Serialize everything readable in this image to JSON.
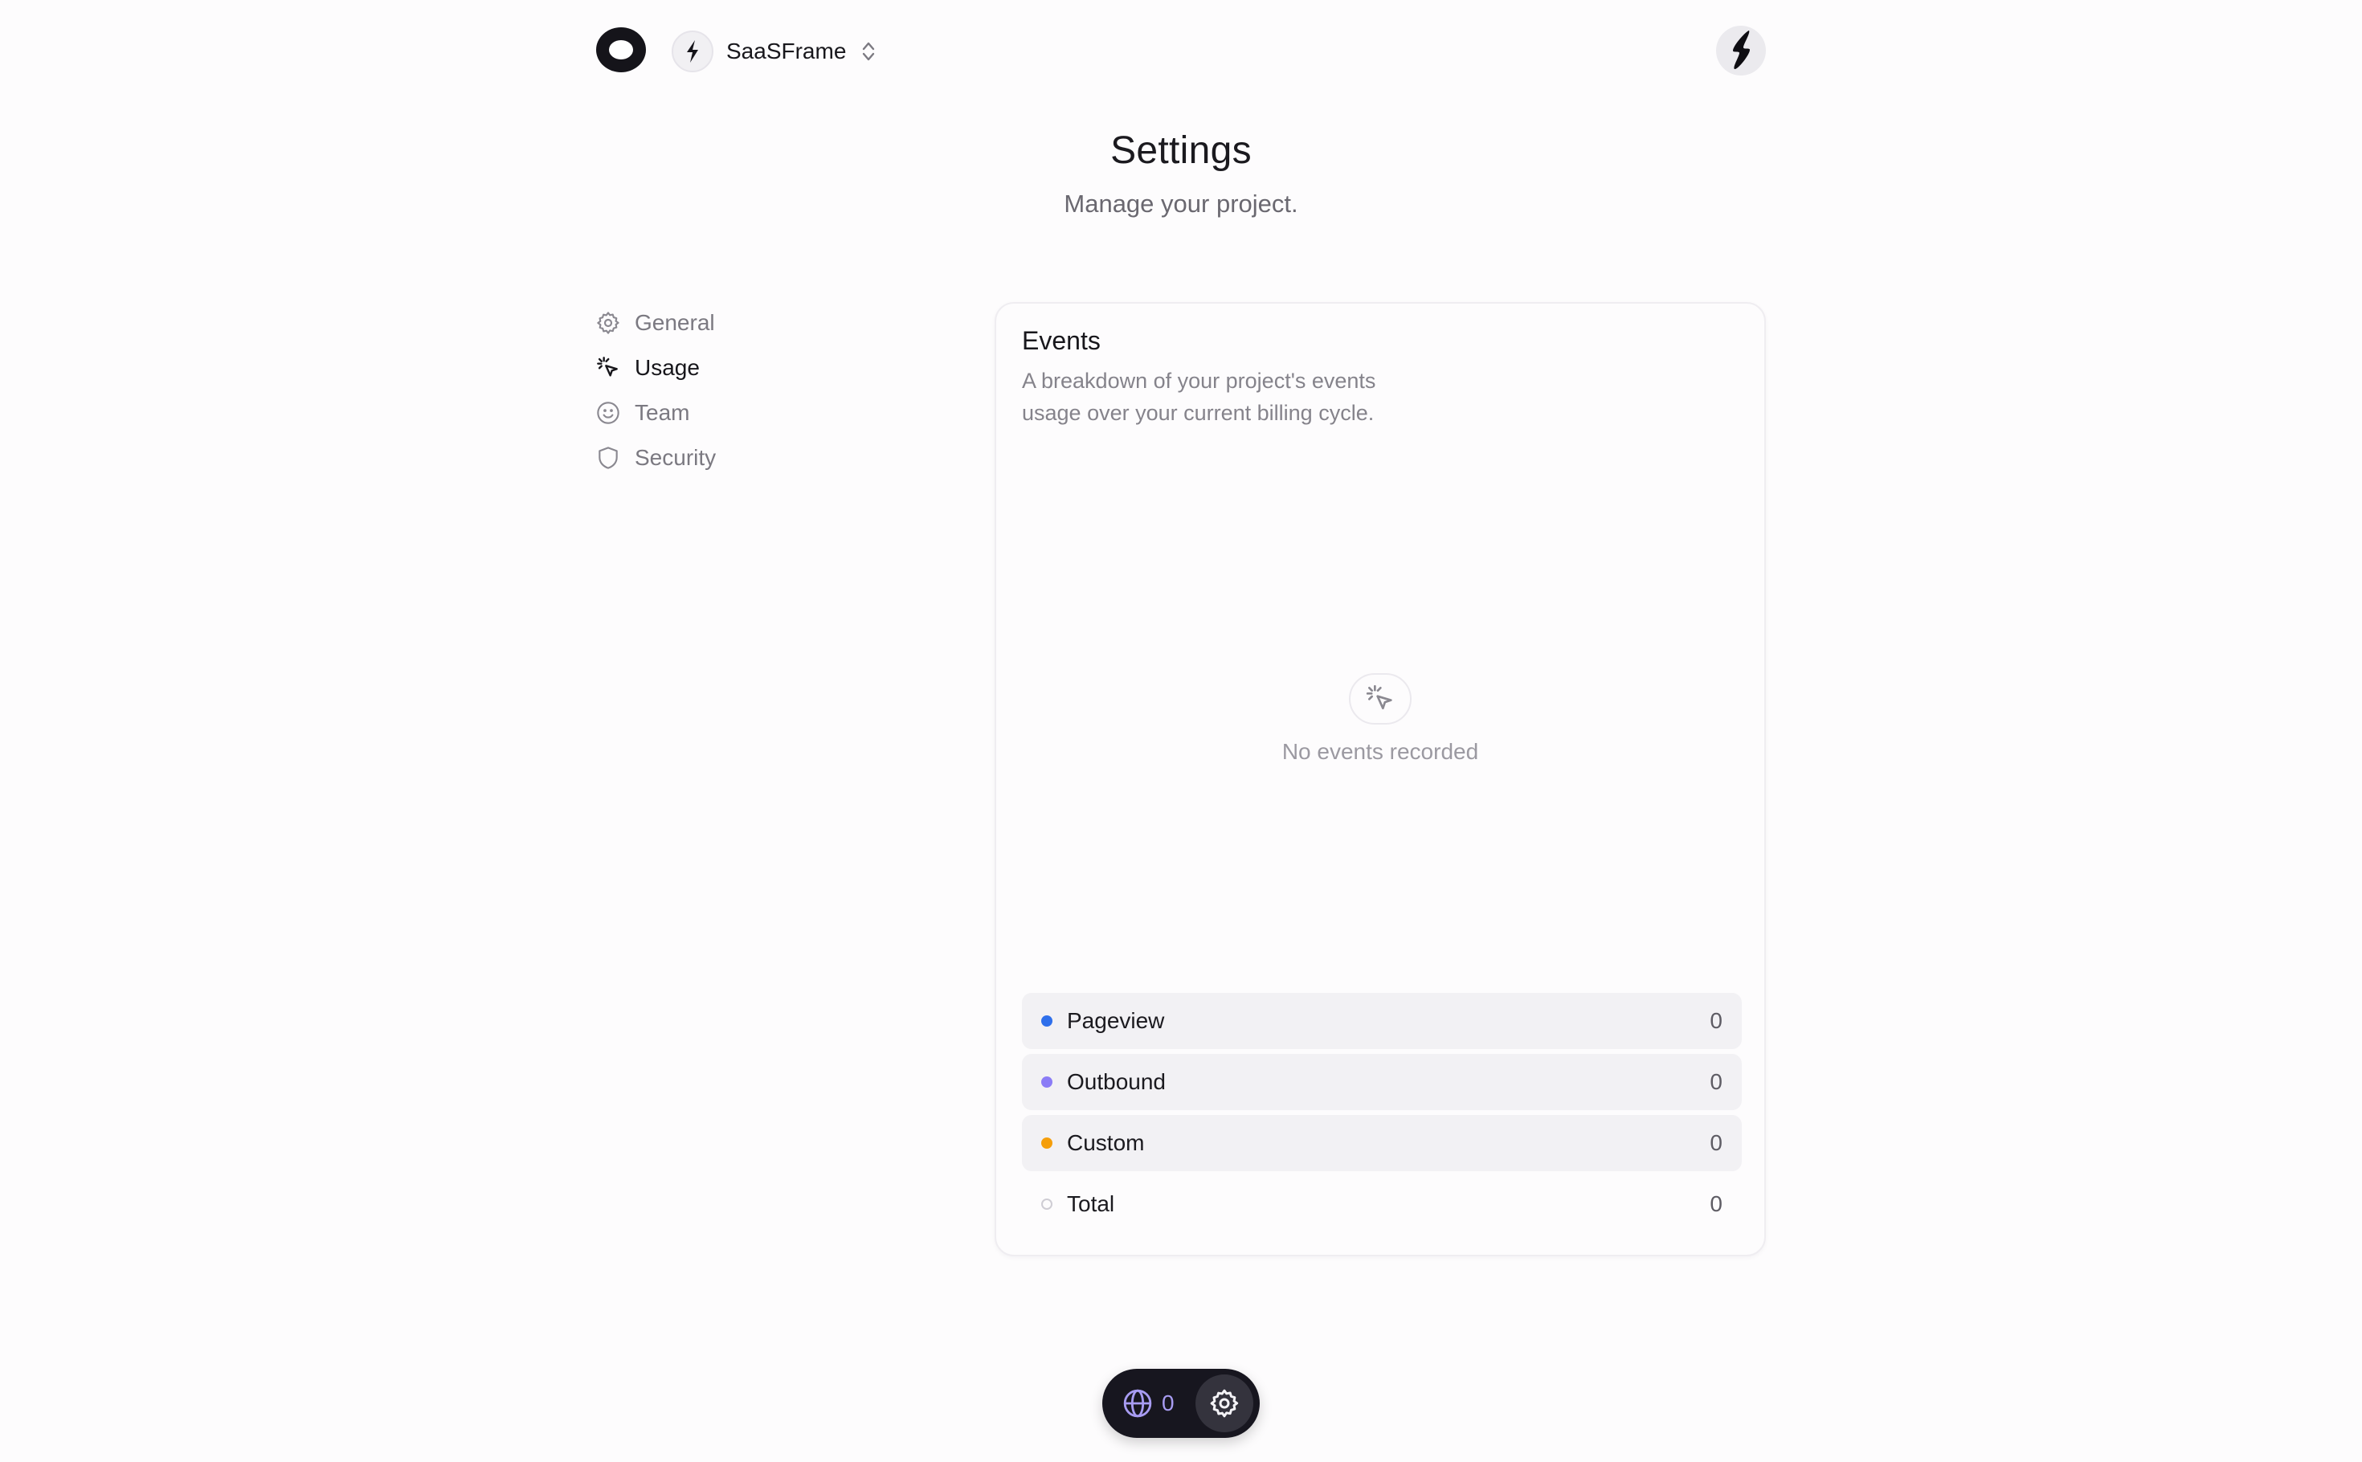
{
  "header": {
    "logo_icon": "ring-logo-icon",
    "project_name": "SaaSFrame",
    "project_icon": "lightning-bolt-icon",
    "switch_icon": "chevron-up-down-icon",
    "user_avatar_icon": "lightning-bolt-icon"
  },
  "page": {
    "title": "Settings",
    "subtitle": "Manage your project."
  },
  "sidebar": {
    "items": [
      {
        "label": "General",
        "icon": "gear-icon",
        "active": false
      },
      {
        "label": "Usage",
        "icon": "cursor-click-icon",
        "active": true
      },
      {
        "label": "Team",
        "icon": "smiley-icon",
        "active": false
      },
      {
        "label": "Security",
        "icon": "shield-icon",
        "active": false
      }
    ]
  },
  "events_card": {
    "title": "Events",
    "description": "A breakdown of your project's events usage over your current billing cycle.",
    "empty_icon": "cursor-click-icon",
    "empty_text": "No events recorded",
    "legend": [
      {
        "label": "Pageview",
        "value": "0",
        "color": "#2f6feb"
      },
      {
        "label": "Outbound",
        "value": "0",
        "color": "#8b7cf6"
      },
      {
        "label": "Custom",
        "value": "0",
        "color": "#f59e0b"
      },
      {
        "label": "Total",
        "value": "0",
        "color": "#cfcdd4"
      }
    ]
  },
  "toolbar": {
    "globe_icon": "globe-icon",
    "count": "0",
    "settings_icon": "gear-icon"
  },
  "colors": {
    "accent_purple": "#a89cf2",
    "toolbar_bg": "#17161f"
  }
}
